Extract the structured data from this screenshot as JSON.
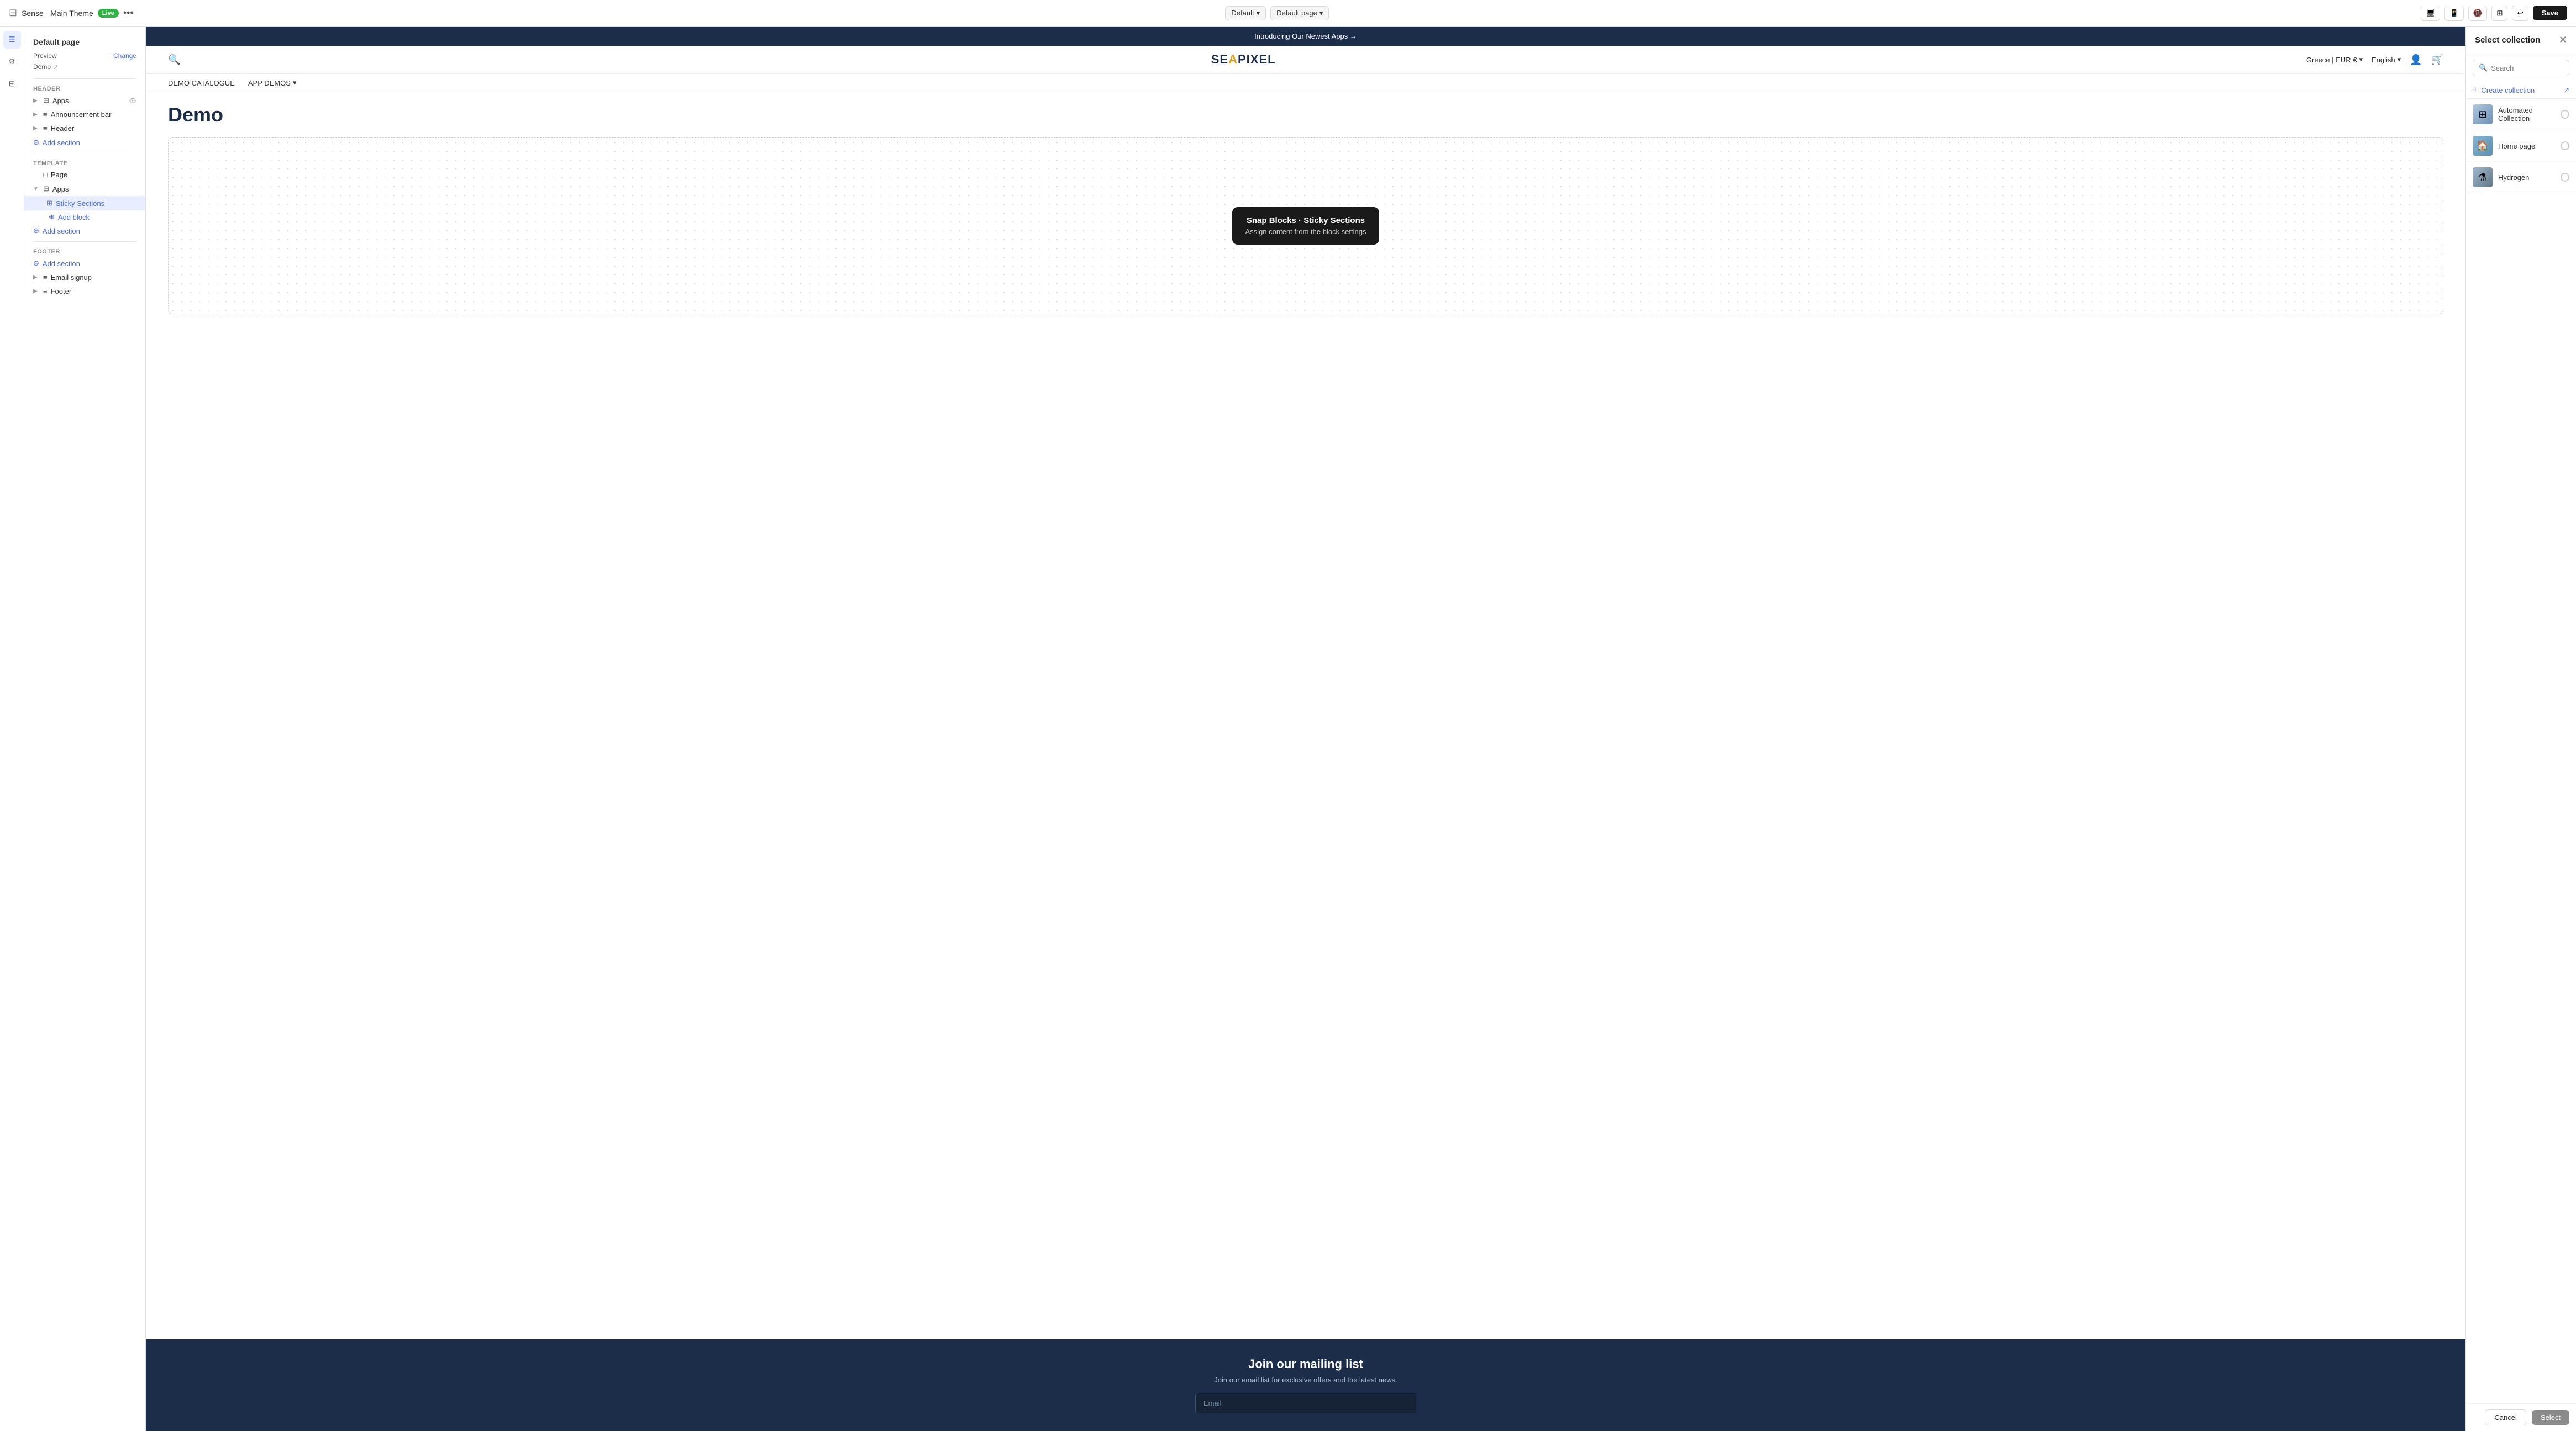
{
  "topbar": {
    "theme_name": "Sense - Main Theme",
    "live_label": "Live",
    "more_icon": "•••",
    "dropdown_default": "Default",
    "dropdown_page": "Default page",
    "icon_buttons": [
      "desktop",
      "tablet",
      "mobile",
      "grid",
      "undo"
    ],
    "save_label": "Save"
  },
  "left_sidebar": {
    "page_title": "Default page",
    "preview_label": "Preview",
    "change_label": "Change",
    "demo_label": "Demo",
    "sections": {
      "header_label": "Header",
      "header_items": [
        {
          "label": "Apps",
          "icon": "⊞",
          "expandable": true
        },
        {
          "label": "Announcement bar",
          "icon": "≡",
          "expandable": true
        },
        {
          "label": "Header",
          "icon": "≡",
          "expandable": true
        }
      ],
      "add_section_1": "Add section",
      "template_label": "Template",
      "template_items": [
        {
          "label": "Page",
          "icon": "□"
        },
        {
          "label": "Apps",
          "icon": "⊞",
          "expandable": true,
          "expanded": true
        }
      ],
      "apps_sub_items": [
        {
          "label": "Sticky Sections",
          "icon": "⊞",
          "active": true
        }
      ],
      "add_block_label": "Add block",
      "add_section_2": "Add section",
      "footer_label": "Footer",
      "footer_items": [
        {
          "label": "Email signup",
          "icon": "≡",
          "expandable": true
        },
        {
          "label": "Footer",
          "icon": "≡",
          "expandable": true
        }
      ],
      "add_section_footer": "Add section"
    }
  },
  "preview": {
    "announcement": "Introducing Our Newest Apps →",
    "logo_text": "SEAPIXEL",
    "logo_accent": "A",
    "nav_left": "Greece | EUR €",
    "nav_lang": "English",
    "menu_items": [
      "DEMO CATALOGUE",
      "APP DEMOS"
    ],
    "page_title": "Demo",
    "tooltip": {
      "title": "Snap Blocks · Sticky Sections",
      "subtitle": "Assign content from the block settings"
    },
    "footer_title": "Join our mailing list",
    "footer_subtitle": "Join our email list for exclusive offers and the latest news.",
    "email_placeholder": "Email"
  },
  "right_panel": {
    "title": "Select collection",
    "search_placeholder": "Search",
    "create_label": "Create collection",
    "collections": [
      {
        "name": "Automated Collection",
        "thumb_class": "auto"
      },
      {
        "name": "Home page",
        "thumb_class": "home"
      },
      {
        "name": "Hydrogen",
        "thumb_class": "hydrogen"
      }
    ],
    "cancel_label": "Cancel",
    "select_label": "Select"
  }
}
